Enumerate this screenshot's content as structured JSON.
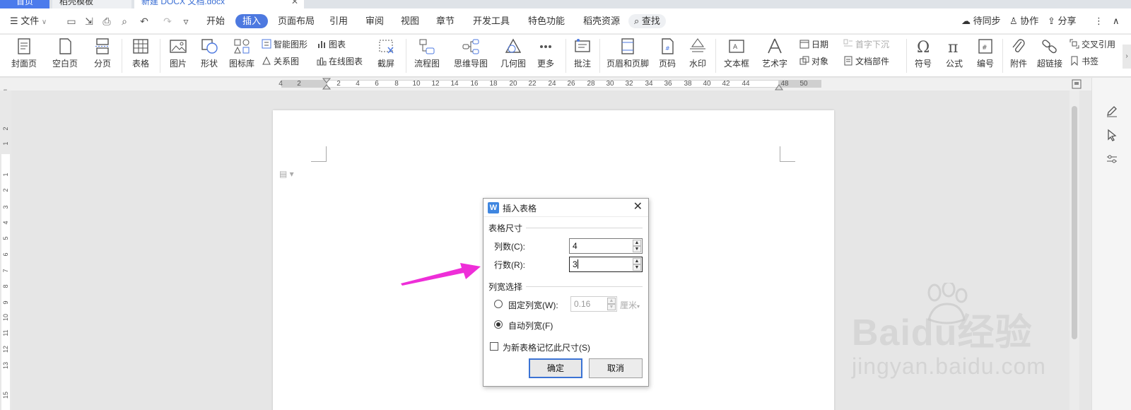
{
  "tabs": [
    {
      "label": "首页"
    },
    {
      "label": "稻壳模板"
    },
    {
      "label": "新建 DOCX 文档.docx"
    }
  ],
  "menubar": {
    "file": "文件",
    "items": [
      "开始",
      "插入",
      "页面布局",
      "引用",
      "审阅",
      "视图",
      "章节",
      "开发工具",
      "特色功能",
      "稻壳资源"
    ],
    "active": "插入",
    "search": "查找",
    "sync": "待同步",
    "collab": "协作",
    "share": "分享"
  },
  "ribbon": {
    "cover": "封面页",
    "blank": "空白页",
    "pagebreak": "分页",
    "table": "表格",
    "picture": "图片",
    "shape": "形状",
    "iconlib": "图标库",
    "smartart": "智能图形",
    "chart": "图表",
    "relation": "关系图",
    "onlinechart": "在线图表",
    "screenshot": "截屏",
    "flowchart": "流程图",
    "mindmap": "思维导图",
    "geometry": "几何图",
    "more": "更多",
    "comment": "批注",
    "headerfooter": "页眉和页脚",
    "pagenum": "页码",
    "watermark": "水印",
    "textbox": "文本框",
    "wordart": "艺术字",
    "date": "日期",
    "object": "对象",
    "dropcap": "首字下沉",
    "docparts": "文档部件",
    "symbol": "符号",
    "formula": "公式",
    "numbering": "编号",
    "attachment": "附件",
    "hyperlink": "超链接",
    "crossref": "交叉引用",
    "bookmark": "书签"
  },
  "ruler": {
    "ticks": [
      "4",
      "2",
      "2",
      "4",
      "6",
      "8",
      "10",
      "12",
      "14",
      "16",
      "18",
      "20",
      "22",
      "24",
      "26",
      "28",
      "30",
      "32",
      "34",
      "36",
      "38",
      "40",
      "42",
      "44",
      "48",
      "50"
    ],
    "vticks": [
      "2",
      "1",
      "1",
      "2",
      "3",
      "4",
      "5",
      "6",
      "7",
      "8",
      "9",
      "10",
      "11",
      "12",
      "13",
      "15"
    ]
  },
  "dialog": {
    "title": "插入表格",
    "size_group": "表格尺寸",
    "cols_label": "列数(C):",
    "cols_value": "4",
    "rows_label": "行数(R):",
    "rows_value": "3",
    "width_group": "列宽选择",
    "fixed_label": "固定列宽(W):",
    "fixed_value": "0.16",
    "fixed_unit": "厘米",
    "auto_label": "自动列宽(F)",
    "remember_label": "为新表格记忆此尺寸(S)",
    "ok": "确定",
    "cancel": "取消"
  },
  "watermark": {
    "line1": "Baidu经验",
    "line2": "jingyan.baidu.com"
  },
  "colors": {
    "accent": "#4d79e0",
    "annotation_arrow": "#ee2ed8"
  }
}
